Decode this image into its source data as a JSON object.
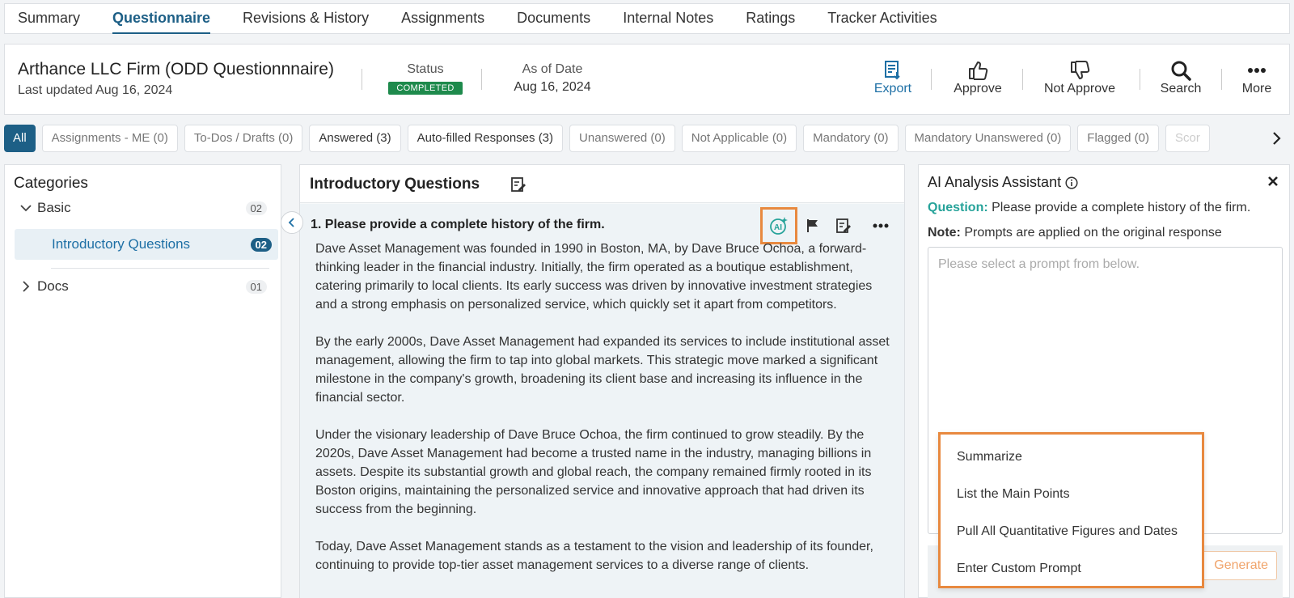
{
  "tabs": [
    {
      "label": "Summary"
    },
    {
      "label": "Questionnaire"
    },
    {
      "label": "Revisions & History"
    },
    {
      "label": "Assignments"
    },
    {
      "label": "Documents"
    },
    {
      "label": "Internal Notes"
    },
    {
      "label": "Ratings"
    },
    {
      "label": "Tracker Activities"
    }
  ],
  "header": {
    "title": "Arthance LLC Firm (ODD Questionnnaire)",
    "updated": "Last updated Aug 16, 2024",
    "status_label": "Status",
    "status_value": "COMPLETED",
    "asof_label": "As of Date",
    "asof_value": "Aug 16, 2024",
    "actions": {
      "export": "Export",
      "approve": "Approve",
      "not_approve": "Not Approve",
      "search": "Search",
      "more": "More"
    }
  },
  "filters": [
    {
      "label": "All"
    },
    {
      "label": "Assignments - ME (0)"
    },
    {
      "label": "To-Dos / Drafts (0)"
    },
    {
      "label": "Answered (3)"
    },
    {
      "label": "Auto-filled Responses (3)"
    },
    {
      "label": "Unanswered (0)"
    },
    {
      "label": "Not Applicable (0)"
    },
    {
      "label": "Mandatory (0)"
    },
    {
      "label": "Mandatory Unanswered (0)"
    },
    {
      "label": "Flagged (0)"
    },
    {
      "label": "Scor"
    }
  ],
  "categories": {
    "title": "Categories",
    "items": [
      {
        "label": "Basic",
        "count": "02"
      },
      {
        "label": "Introductory Questions",
        "count": "02"
      },
      {
        "label": "Docs",
        "count": "01"
      }
    ]
  },
  "question_panel": {
    "title": "Introductory Questions",
    "question": "1.  Please provide a complete history of the firm.",
    "answer": [
      "Dave Asset Management was founded in 1990 in Boston, MA, by Dave Bruce Ochoa, a forward-thinking leader in the financial industry. Initially, the firm operated as a boutique establishment, catering primarily to local clients. Its early success was driven by innovative investment strategies and a strong emphasis on personalized service, which quickly set it apart from competitors.",
      "By the early 2000s, Dave Asset Management had expanded its services to include institutional asset management, allowing the firm to tap into global markets. This strategic move marked a significant milestone in the company's growth, broadening its client base and increasing its influence in the financial sector.",
      "Under the visionary leadership of Dave Bruce Ochoa, the firm continued to grow steadily. By the 2020s, Dave Asset Management had become a trusted name in the industry, managing billions in assets. Despite its substantial growth and global reach, the company remained firmly rooted in its Boston origins, maintaining the personalized service and innovative approach that had driven its success from the beginning.",
      "Today, Dave Asset Management stands as a testament to the vision and leadership of its founder, continuing to provide top-tier asset management services to a diverse range of clients."
    ]
  },
  "ai_assistant": {
    "title": "AI Analysis Assistant",
    "question_label": "Question:",
    "question_text": " Please provide a complete history of the firm.",
    "note_label": "Note:",
    "note_text": " Prompts are applied on the original response",
    "placeholder": "Please select a prompt from below.",
    "generate": "Generate",
    "prompts": [
      {
        "label": "Summarize"
      },
      {
        "label": "List the Main Points"
      },
      {
        "label": "Pull All Quantitative Figures and Dates"
      },
      {
        "label": "Enter Custom Prompt"
      }
    ]
  },
  "colors": {
    "primary": "#1d5f86",
    "status_green": "#1e8a4c",
    "highlight_orange": "#e8893f",
    "teal": "#27a39a"
  }
}
